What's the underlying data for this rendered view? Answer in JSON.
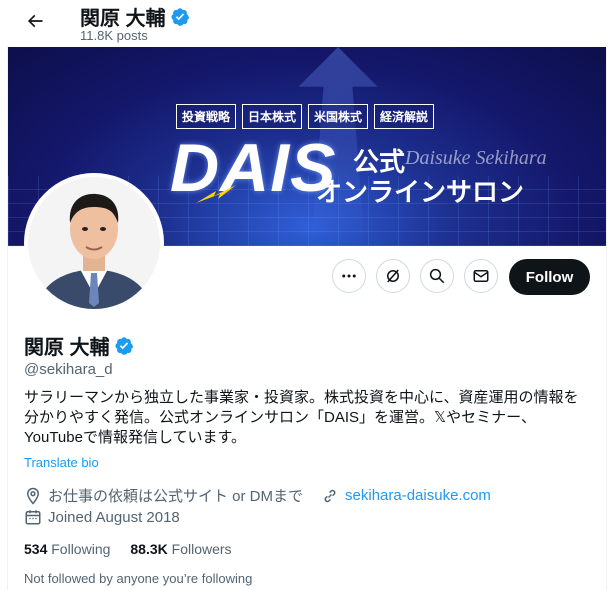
{
  "header": {
    "back_label": "Back",
    "name": "関原 大輔",
    "posts": "11.8K posts"
  },
  "banner": {
    "tags": [
      "投資戦略",
      "日本株式",
      "米国株式",
      "経済解説"
    ],
    "logo": "DAIS",
    "koushiki": "公式",
    "romaji": "Daisuke Sekihara",
    "salon": "オンラインサロン"
  },
  "actions": {
    "more": "More",
    "grok": "Grok",
    "search": "Search",
    "message": "Message",
    "follow_label": "Follow"
  },
  "profile": {
    "name": "関原 大輔",
    "handle": "@sekihara_d",
    "bio_lines": [
      "サラリーマンから独立した事業家・投資家。株式投資を中心に、資産運用の情報を",
      "分かりやすく発信。公式オンラインサロン「DAIS」を運営。𝕏やセミナー、",
      "YouTubeで情報発信しています。"
    ],
    "translate": "Translate bio",
    "location": "お仕事の依頼は公式サイト or DMまで",
    "website": "sekihara-daisuke.com",
    "joined": "Joined August 2018",
    "following_count": "534",
    "following_label": "Following",
    "followers_count": "88.3K",
    "followers_label": "Followers",
    "not_followed": "Not followed by anyone you’re following"
  },
  "colors": {
    "accent": "#1d9bf0",
    "text": "#0f1419",
    "muted": "#536471",
    "banner_dark": "#14176a"
  }
}
